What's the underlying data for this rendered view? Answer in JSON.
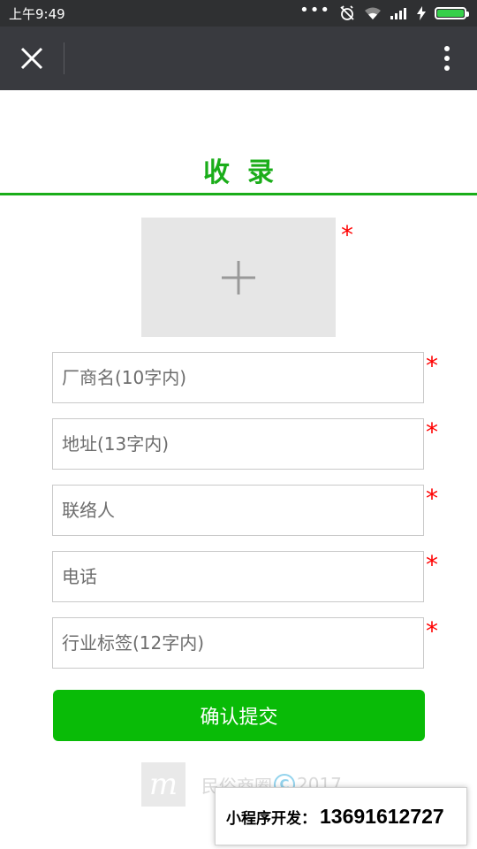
{
  "status_bar": {
    "time": "上午9:49",
    "dots": "•••",
    "battery_level": 1.0,
    "battery_color": "#36d04a"
  },
  "nav": {
    "close_icon": "close-icon",
    "more_icon": "more-vertical-icon"
  },
  "page": {
    "title": "收录",
    "accent_color": "#1aad19"
  },
  "upload": {
    "icon": "plus-icon",
    "required_mark": "*"
  },
  "form": {
    "fields": [
      {
        "placeholder": "厂商名(10字内)",
        "value": "",
        "required_mark": "*"
      },
      {
        "placeholder": "地址(13字内)",
        "value": "",
        "required_mark": "*"
      },
      {
        "placeholder": "联络人",
        "value": "",
        "required_mark": "*"
      },
      {
        "placeholder": "电话",
        "value": "",
        "required_mark": "*"
      },
      {
        "placeholder": "行业标签(12字内)",
        "value": "",
        "required_mark": "*"
      }
    ],
    "submit_label": "确认提交",
    "submit_color": "#09bb07"
  },
  "footer": {
    "logo_letter": "m",
    "brand": "民俗商圈",
    "copyright_symbol": "C",
    "year": "2017"
  },
  "promo": {
    "label": "小程序开发：",
    "phone": "13691612727"
  }
}
